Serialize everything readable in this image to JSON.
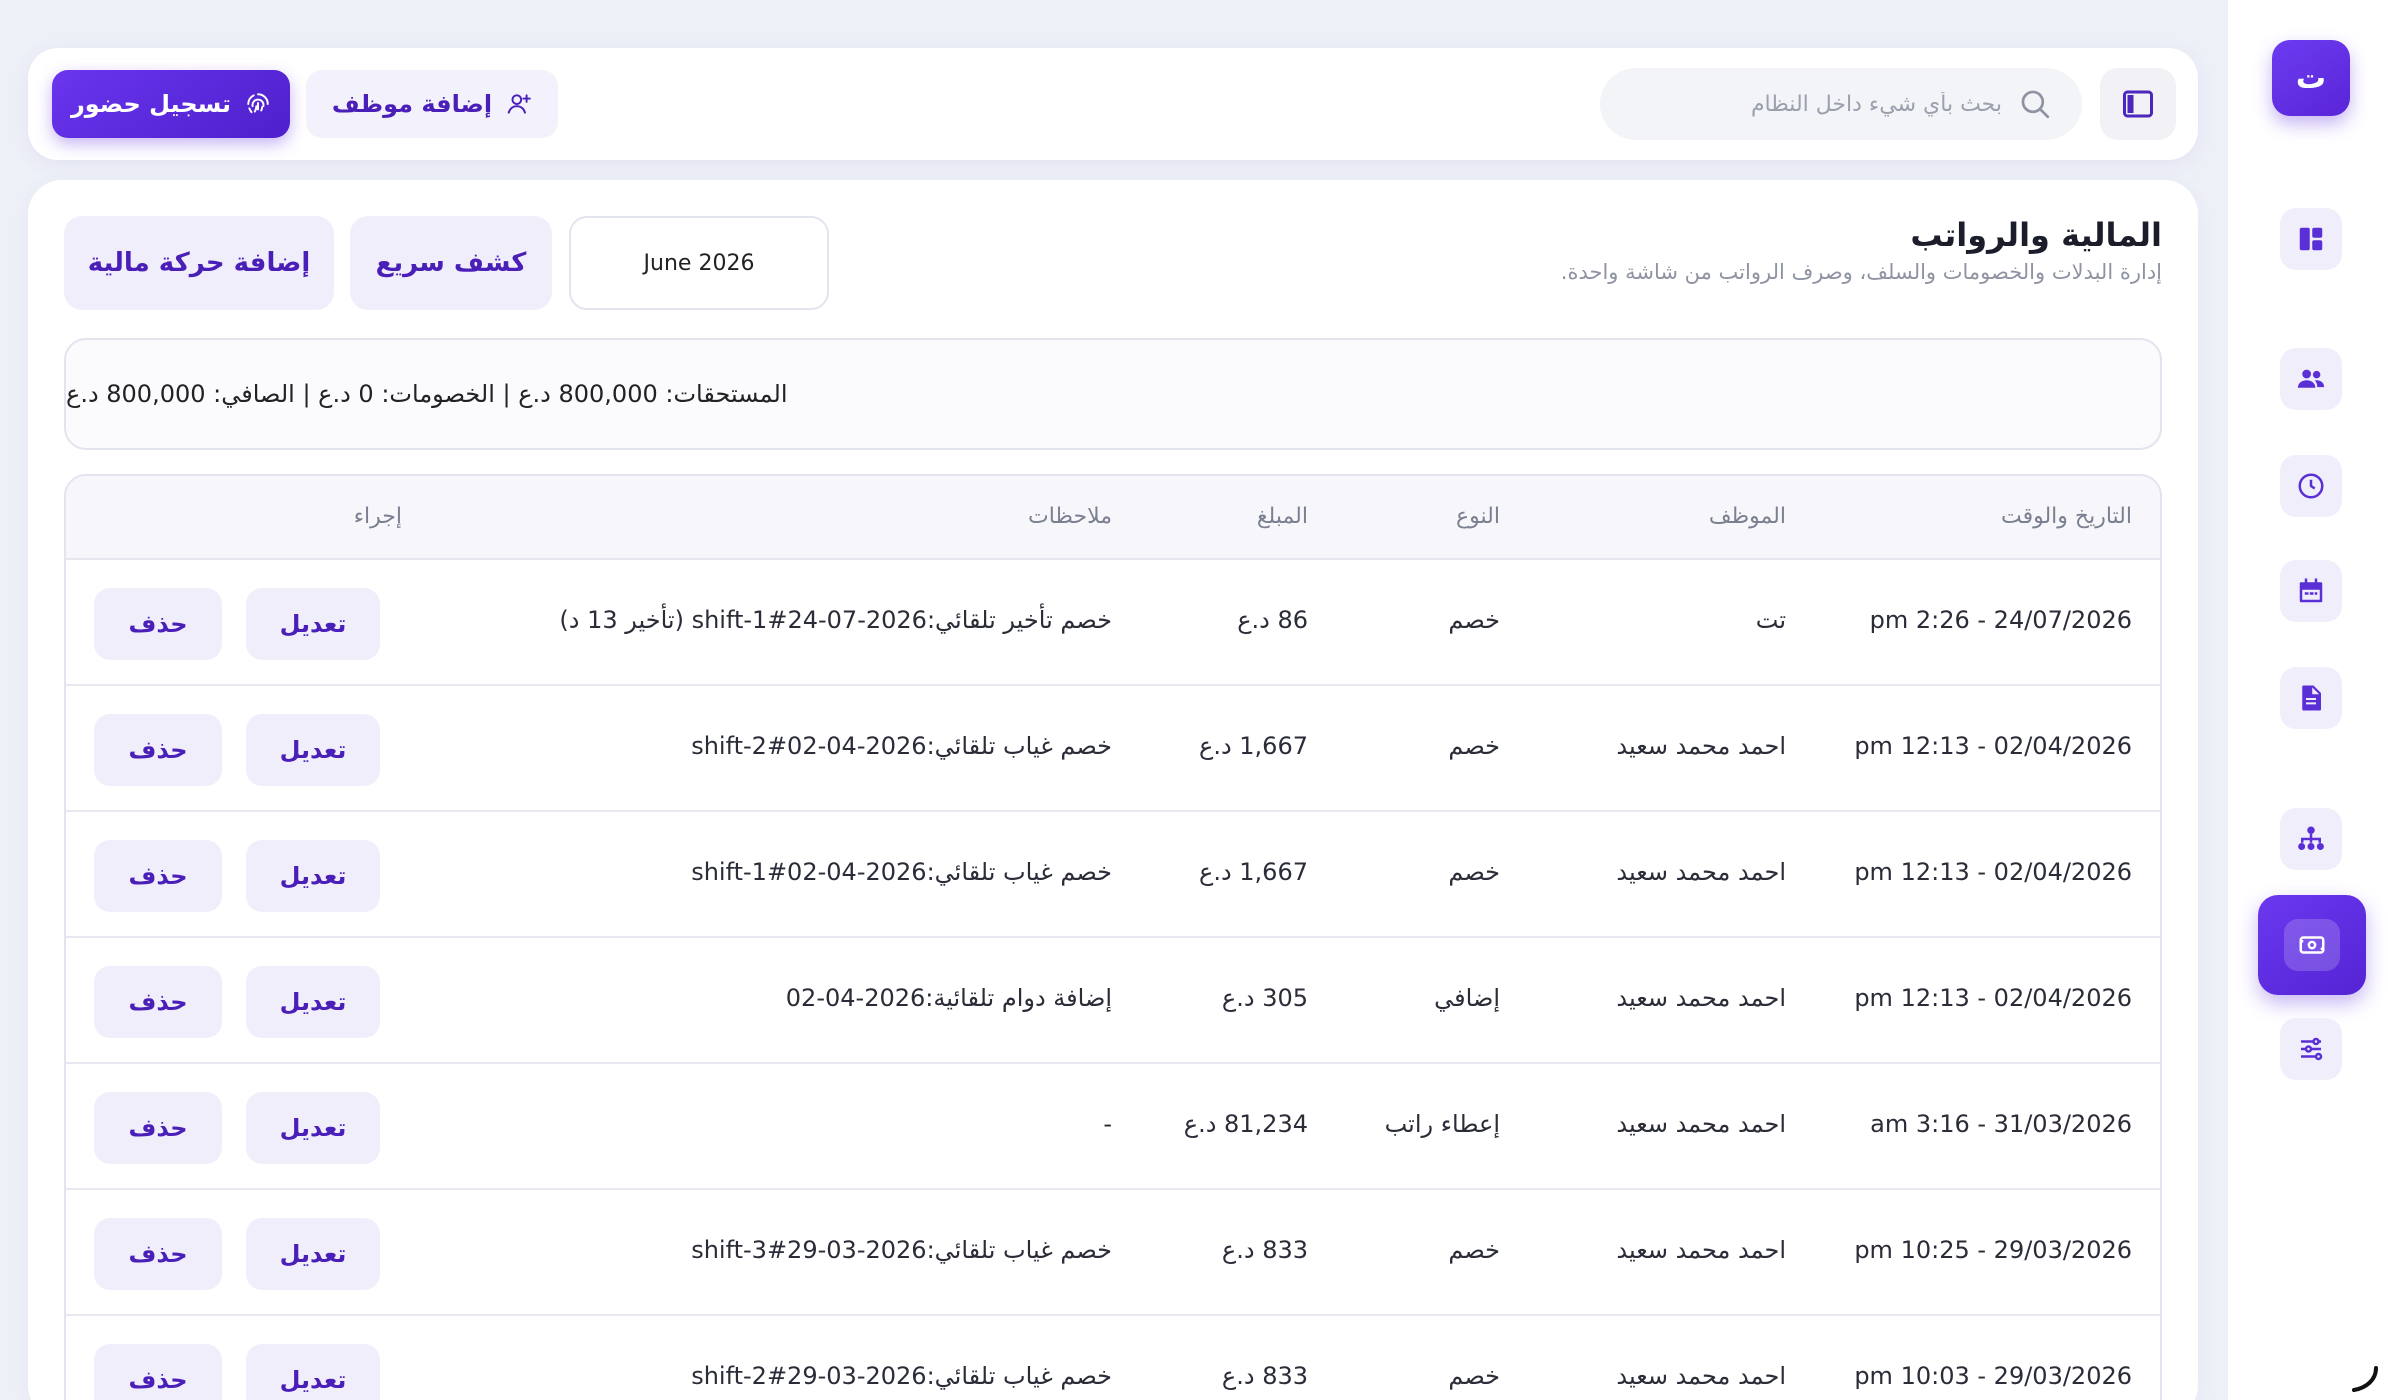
{
  "sidebar": {
    "logo_letter": "ت",
    "items": [
      {
        "icon": "dashboard-icon"
      },
      {
        "icon": "users-icon"
      },
      {
        "icon": "clock-icon"
      },
      {
        "icon": "calendar-icon"
      },
      {
        "icon": "document-icon"
      },
      {
        "icon": "org-chart-icon"
      },
      {
        "icon": "cash-icon",
        "active": true
      },
      {
        "icon": "sliders-icon"
      }
    ],
    "accent": "#5a24d8"
  },
  "topbar": {
    "checkin_label": "تسجيل حضور",
    "add_employee_label": "إضافة موظف",
    "search_placeholder": "بحث بأي شيء داخل النظام"
  },
  "page": {
    "title": "المالية والرواتب",
    "subtitle": "إدارة البدلات والخصومات والسلف، وصرف الرواتب من شاشة واحدة.",
    "month": "June 2026",
    "quick_report_label": "كشف سريع",
    "add_financial_label": "إضافة حركة مالية",
    "summary": "المستحقات: 800,000 د.ع | الخصومات: 0 د.ع | الصافي: 800,000 د.ع"
  },
  "table": {
    "headers": {
      "datetime": "التاريخ والوقت",
      "employee": "الموظف",
      "type": "النوع",
      "amount": "المبلغ",
      "notes": "ملاحظات",
      "action": "إجراء"
    },
    "edit_label": "تعديل",
    "delete_label": "حذف",
    "rows": [
      {
        "datetime": "24/07/2026 - 2:26 pm",
        "employee": "تت",
        "type": "خصم",
        "amount": "86 د.ع",
        "notes": "خصم تأخير تلقائي:2026-07-24#shift-1 (تأخير 13 د)"
      },
      {
        "datetime": "02/04/2026 - 12:13 pm",
        "employee": "احمد محمد سعيد",
        "type": "خصم",
        "amount": "1,667 د.ع",
        "notes": "خصم غياب تلقائي:2026-04-02#shift-2"
      },
      {
        "datetime": "02/04/2026 - 12:13 pm",
        "employee": "احمد محمد سعيد",
        "type": "خصم",
        "amount": "1,667 د.ع",
        "notes": "خصم غياب تلقائي:2026-04-02#shift-1"
      },
      {
        "datetime": "02/04/2026 - 12:13 pm",
        "employee": "احمد محمد سعيد",
        "type": "إضافي",
        "amount": "305 د.ع",
        "notes": "إضافة دوام تلقائية:2026-04-02"
      },
      {
        "datetime": "31/03/2026 - 3:16 am",
        "employee": "احمد محمد سعيد",
        "type": "إعطاء راتب",
        "amount": "81,234 د.ع",
        "notes": "-"
      },
      {
        "datetime": "29/03/2026 - 10:25 pm",
        "employee": "احمد محمد سعيد",
        "type": "خصم",
        "amount": "833 د.ع",
        "notes": "خصم غياب تلقائي:2026-03-29#shift-3"
      },
      {
        "datetime": "29/03/2026 - 10:03 pm",
        "employee": "احمد محمد سعيد",
        "type": "خصم",
        "amount": "833 د.ع",
        "notes": "خصم غياب تلقائي:2026-03-29#shift-2"
      }
    ]
  }
}
